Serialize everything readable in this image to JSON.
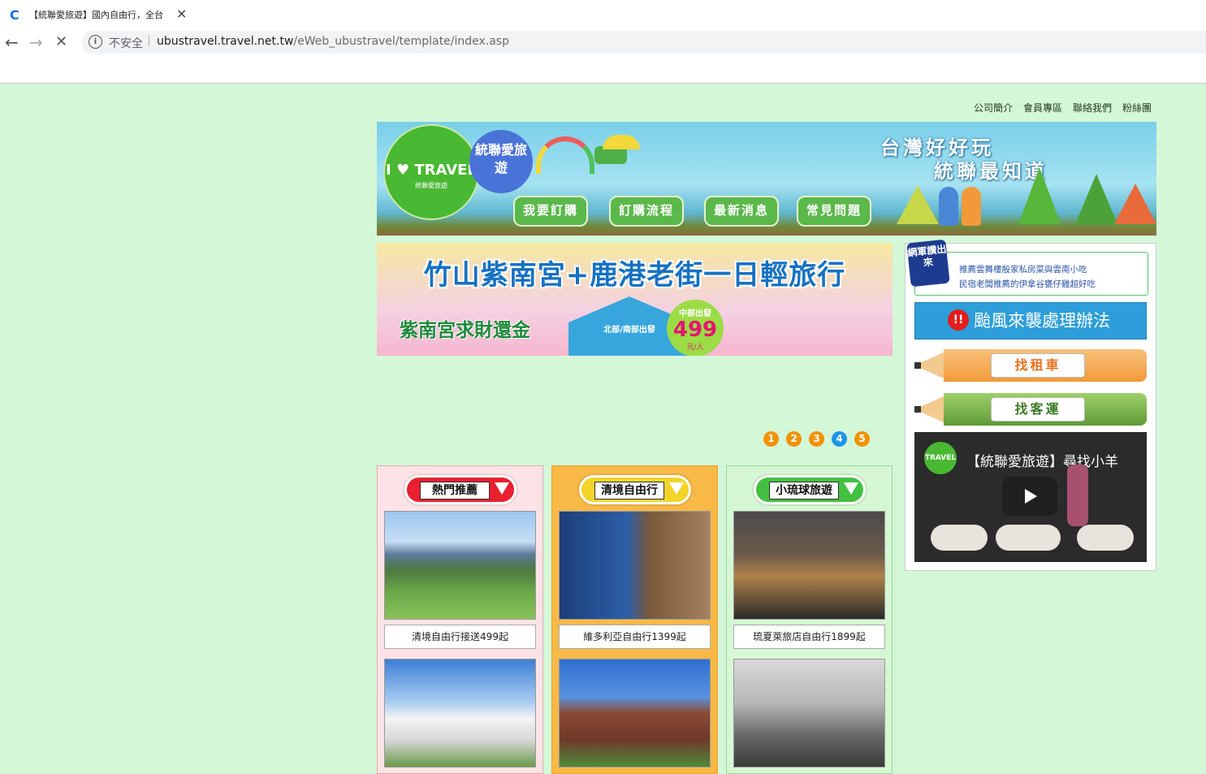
{
  "browser": {
    "tab_title": "【統聯愛旅遊】國內自由行，全台",
    "close_icon": "×",
    "insecure_label": "不安全",
    "url_host": "ubustravel.travel.net.tw",
    "url_path": "/eWeb_ubustravel/template/index.asp"
  },
  "header_links": [
    "公司簡介",
    "會員專區",
    "聯絡我們",
    "粉絲團"
  ],
  "banner": {
    "logo_main": "I ♥ TRAVEL",
    "logo_sub": "統聯愛旅遊",
    "logo_circle": "統聯愛旅遊",
    "slogan_1": "台灣好好玩",
    "slogan_2": "統聯最知道",
    "nav": [
      "我要訂購",
      "訂購流程",
      "最新消息",
      "常見問題"
    ]
  },
  "promo": {
    "title": "竹山紫南宮+鹿港老街一日輕旅行",
    "subtitle": "紫南宮求財還金",
    "house_text": "北部/南部出發",
    "price_label": "中部出發",
    "price": "499",
    "price_unit": "元/人"
  },
  "carousel": {
    "pages": [
      "1",
      "2",
      "3",
      "4",
      "5"
    ],
    "active": 4
  },
  "columns": [
    {
      "header": "熱門推薦",
      "caption": "清境自由行接送499起"
    },
    {
      "header": "清境自由行",
      "caption": "維多利亞自由行1399起"
    },
    {
      "header": "小琉球旅遊",
      "caption": "琉夏萊旅店自由行1899起"
    }
  ],
  "sidebar": {
    "army_badge": "網軍讚出來",
    "army_line1": "推薦雲舞樓殷家私房菜與雲南小吃",
    "army_line2": "民宿老闆推薦的伊拿谷甕仔雞超好吃",
    "typhoon": "颱風來襲處理辦法",
    "typhoon_icon": "!!",
    "rent_car": "找租車",
    "find_bus": "找客運",
    "video_channel": "TRAVEL",
    "video_title": "【統聯愛旅遊】尋找小羊"
  },
  "colors": {
    "page_bg": "#d4f7d8",
    "accent_orange": "#f29200",
    "accent_blue": "#1e96e6"
  }
}
